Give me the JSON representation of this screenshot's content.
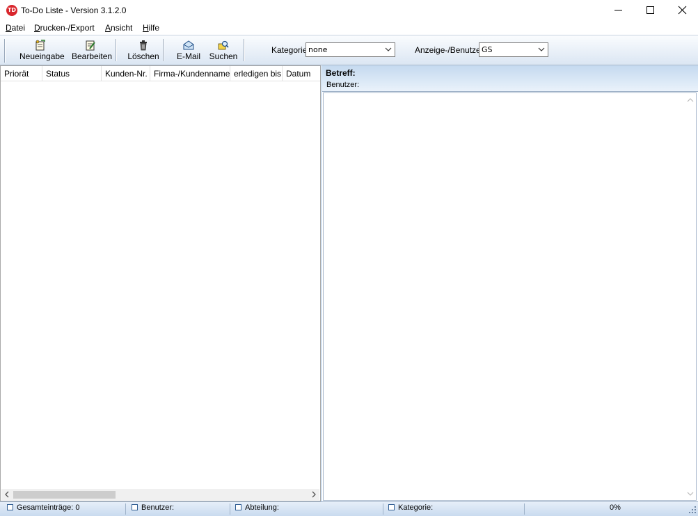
{
  "window": {
    "icon_text": "TD",
    "title": "To-Do Liste - Version 3.1.2.0",
    "controls": {
      "minimize_icon": "minimize-icon",
      "maximize_icon": "maximize-icon",
      "close_icon": "close-icon"
    }
  },
  "menu": [
    {
      "accel": "D",
      "rest": "atei"
    },
    {
      "accel": "D",
      "rest": "rucken-/Export"
    },
    {
      "accel": "A",
      "rest": "nsicht"
    },
    {
      "accel": "H",
      "rest": "ilfe"
    }
  ],
  "toolbar": {
    "new_label": "Neueingabe",
    "edit_label": "Bearbeiten",
    "delete_label": "Löschen",
    "email_label": "E-Mail",
    "search_label": "Suchen",
    "category_label": "Kategorie",
    "category_value": "none",
    "user_label": "Anzeige-/Benutzer",
    "user_value": "GS"
  },
  "list": {
    "columns": [
      "Priorät",
      "Status",
      "Kunden-Nr.",
      "Firma-/Kundenname",
      "erledigen bis",
      "Datum"
    ],
    "rows": []
  },
  "detail": {
    "subject_label": "Betreff:",
    "user_label": "Benutzer:"
  },
  "status": {
    "total": "Gesamteinträge: 0",
    "user": "Benutzer:",
    "department": "Abteilung:",
    "category": "Kategorie:",
    "progress": "0%"
  },
  "colors": {
    "accent": "#2f5d92",
    "toolbar_bg": "#dbe6f3",
    "app_icon": "#d9262c"
  }
}
